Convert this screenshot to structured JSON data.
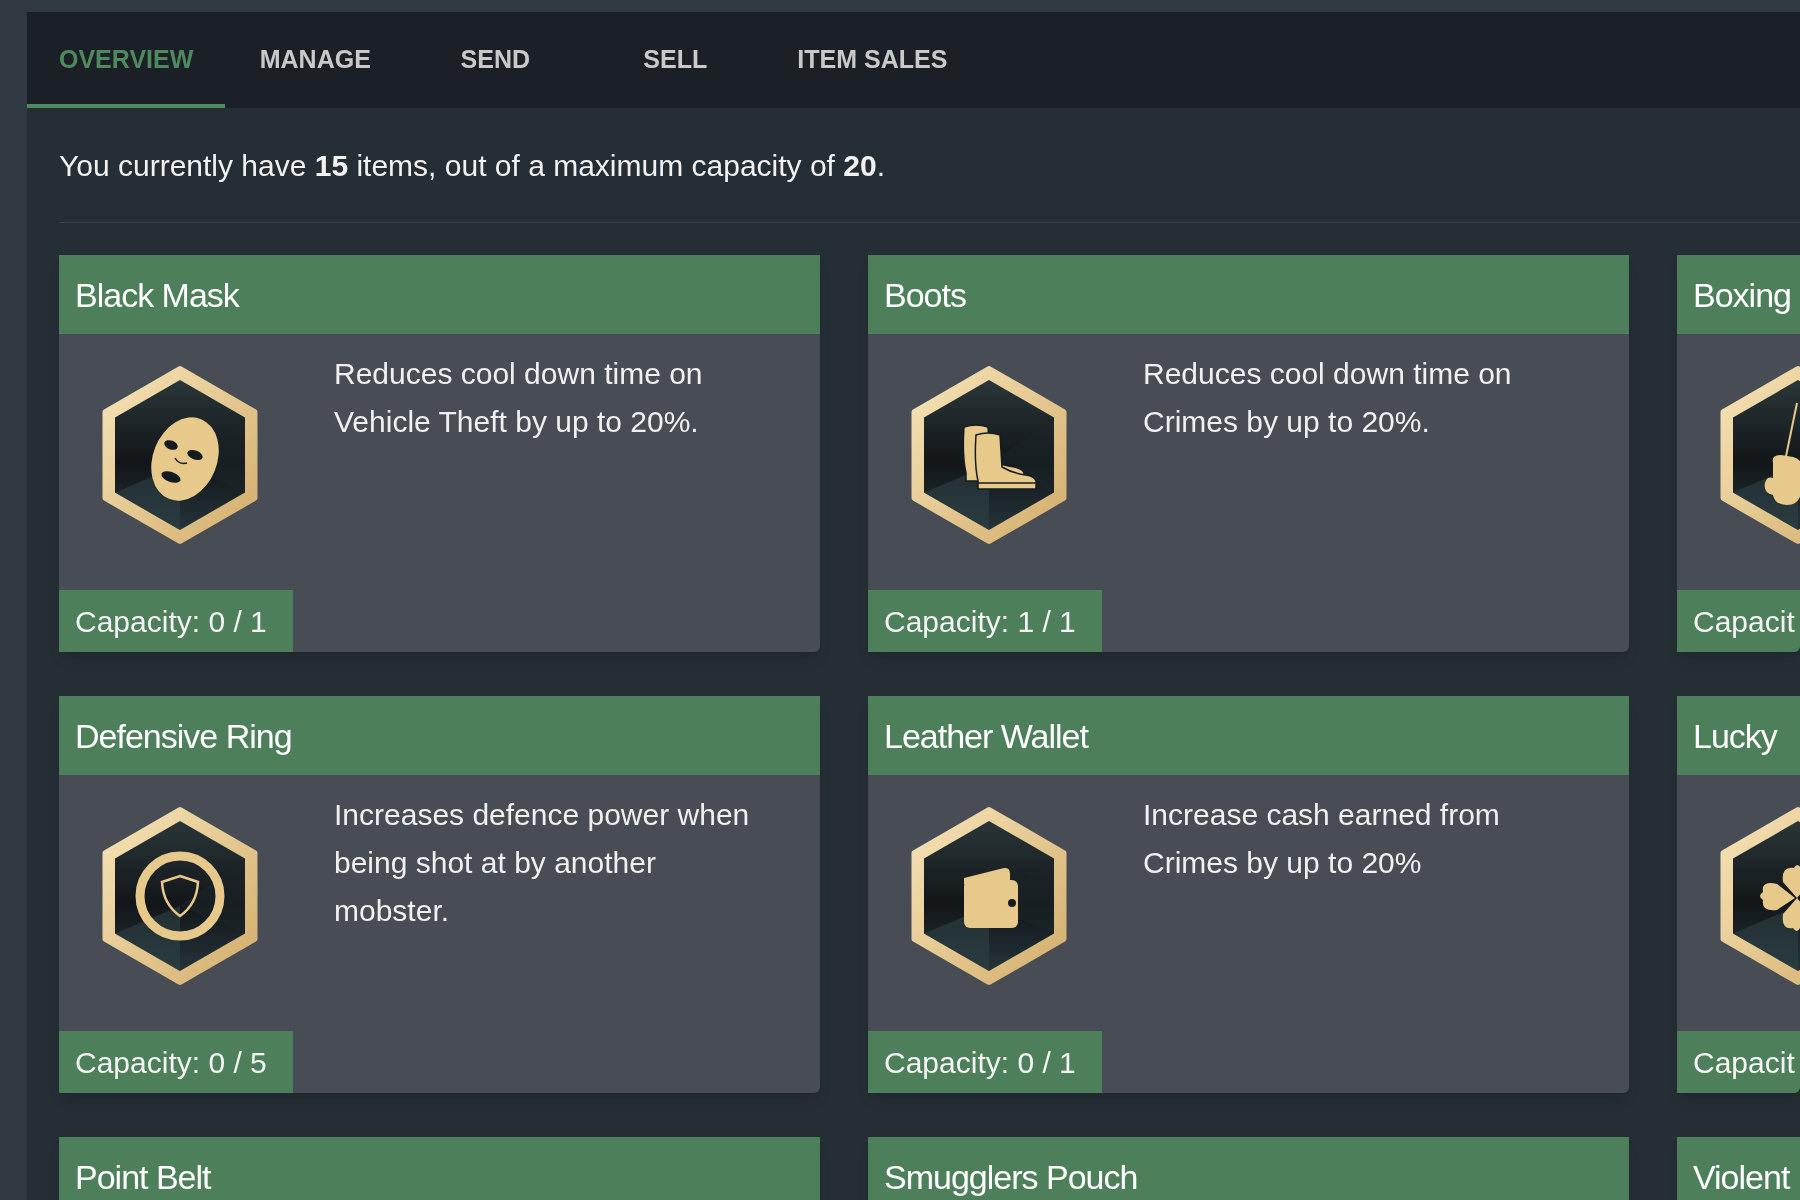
{
  "tabs": [
    {
      "label": "OVERVIEW",
      "selected": true
    },
    {
      "label": "MANAGE",
      "selected": false
    },
    {
      "label": "SEND",
      "selected": false
    },
    {
      "label": "SELL",
      "selected": false
    },
    {
      "label": "ITEM SALES",
      "selected": false
    }
  ],
  "summary": "You currently have **15** items, out of a maximum capacity of **20**.",
  "items": [
    {
      "title": "Black Mask",
      "description": "Reduces cool down time on Vehicle Theft by up to 20%.",
      "capacity": "Capacity: 0 / 1"
    },
    {
      "title": "Boots",
      "description": "Reduces cool down time on Crimes by up to 20%.",
      "capacity": "Capacity: 1 / 1"
    },
    {
      "title": "Boxing",
      "capacity": "Capacit"
    },
    {
      "title": "Defensive Ring",
      "description": "Increases defence power when being shot at by another mobster.",
      "capacity": "Capacity: 0 / 5"
    },
    {
      "title": "Leather Wallet",
      "description": "Increase cash earned from Crimes by up to 20%",
      "capacity": "Capacity: 0 / 1"
    },
    {
      "title": "Lucky",
      "capacity": "Capacit"
    },
    {
      "title": "Point Belt"
    },
    {
      "title": "Smugglers Pouch"
    },
    {
      "title": "Violent"
    }
  ]
}
